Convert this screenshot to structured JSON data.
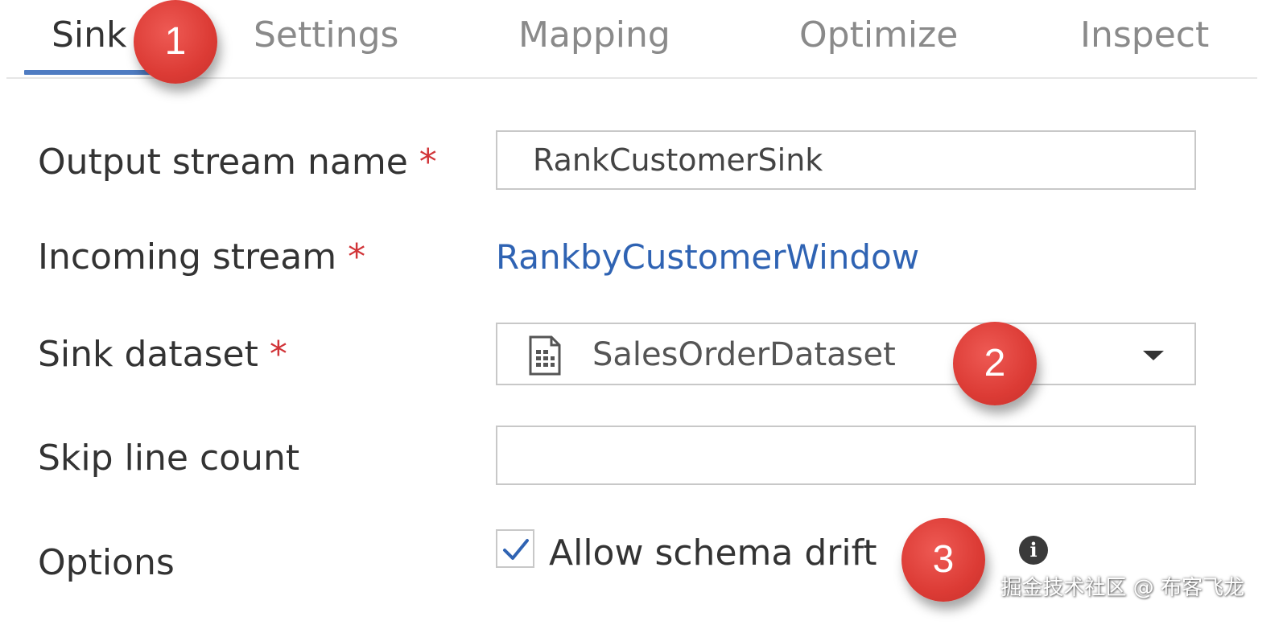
{
  "tabs": [
    {
      "label": "Sink",
      "active": true
    },
    {
      "label": "Settings",
      "active": false
    },
    {
      "label": "Mapping",
      "active": false
    },
    {
      "label": "Optimize",
      "active": false
    },
    {
      "label": "Inspect",
      "active": false
    }
  ],
  "form": {
    "output_stream_name": {
      "label": "Output stream name",
      "required_marker": "*",
      "value": "RankCustomerSink"
    },
    "incoming_stream": {
      "label": "Incoming stream",
      "required_marker": "*",
      "value": "RankbyCustomerWindow"
    },
    "sink_dataset": {
      "label": "Sink dataset",
      "required_marker": "*",
      "value": "SalesOrderDataset",
      "icon": "dataset-file-icon"
    },
    "skip_line_count": {
      "label": "Skip line count",
      "value": ""
    },
    "options": {
      "label": "Options",
      "allow_schema_drift": {
        "label": "Allow schema drift",
        "checked": true
      },
      "info_icon": "info-icon"
    }
  },
  "callouts": [
    "1",
    "2",
    "3"
  ],
  "watermark": "掘金技术社区 @ 布客飞龙",
  "colors": {
    "accent": "#4f7cc2",
    "link": "#2f63b3",
    "required": "#d13438",
    "callout": "#dc3b35"
  }
}
